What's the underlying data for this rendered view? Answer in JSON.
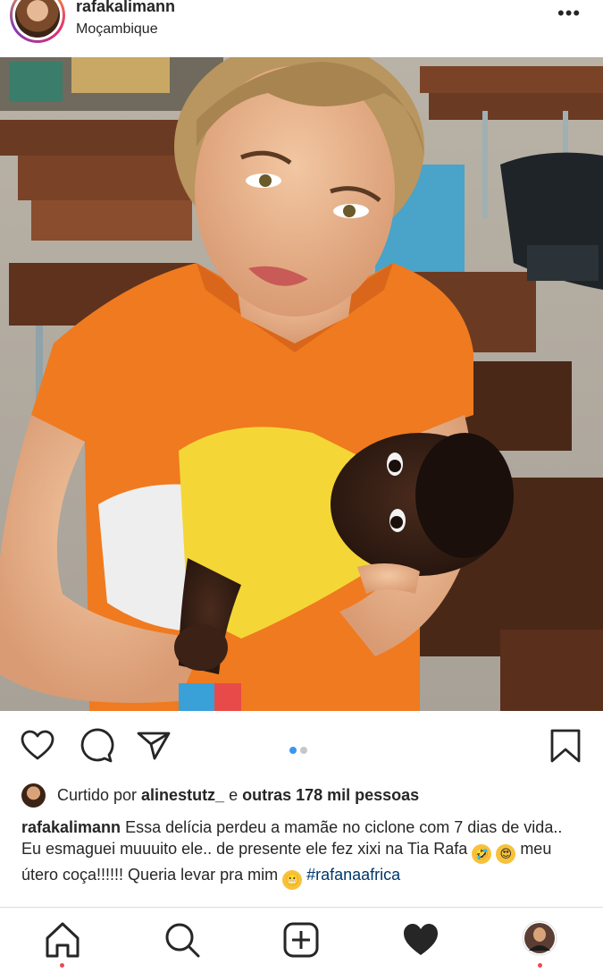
{
  "post": {
    "username": "rafakalimann",
    "location": "Moçambique",
    "more_label": "•••"
  },
  "photo": {
    "alt": "Woman in orange shirt holding a baby in a yellow shirt in a classroom"
  },
  "carousel": {
    "page": 1,
    "total": 2,
    "active_color": "#3897f0",
    "inactive_color": "#c7c7c7"
  },
  "likes": {
    "prefix": "Curtido por ",
    "user": "alinestutz_",
    "middle": " e ",
    "others": "outras 178 mil pessoas"
  },
  "caption": {
    "username": "rafakalimann",
    "text_1": " Essa delícia perdeu a mamãe no ciclone com 7 dias de vida.. Eu esmaguei muuuito ele.. de presente ele fez xixi na Tia Rafa ",
    "text_2": "  meu útero coça!!!!!! Queria levar pra mim ",
    "hashtag": "#rafanaafrica",
    "emoji_1": "🤣",
    "emoji_2": "😍",
    "emoji_3": "😬"
  },
  "icons": {
    "like": "heart-outline-icon",
    "comment": "comment-icon",
    "share": "paper-plane-icon",
    "save": "bookmark-icon",
    "home": "home-icon",
    "search": "search-icon",
    "new_post": "plus-square-icon",
    "activity": "heart-filled-icon",
    "profile": "profile-avatar-icon"
  },
  "colors": {
    "text": "#262626",
    "hashtag": "#00376b",
    "notification": "#ed4956"
  }
}
